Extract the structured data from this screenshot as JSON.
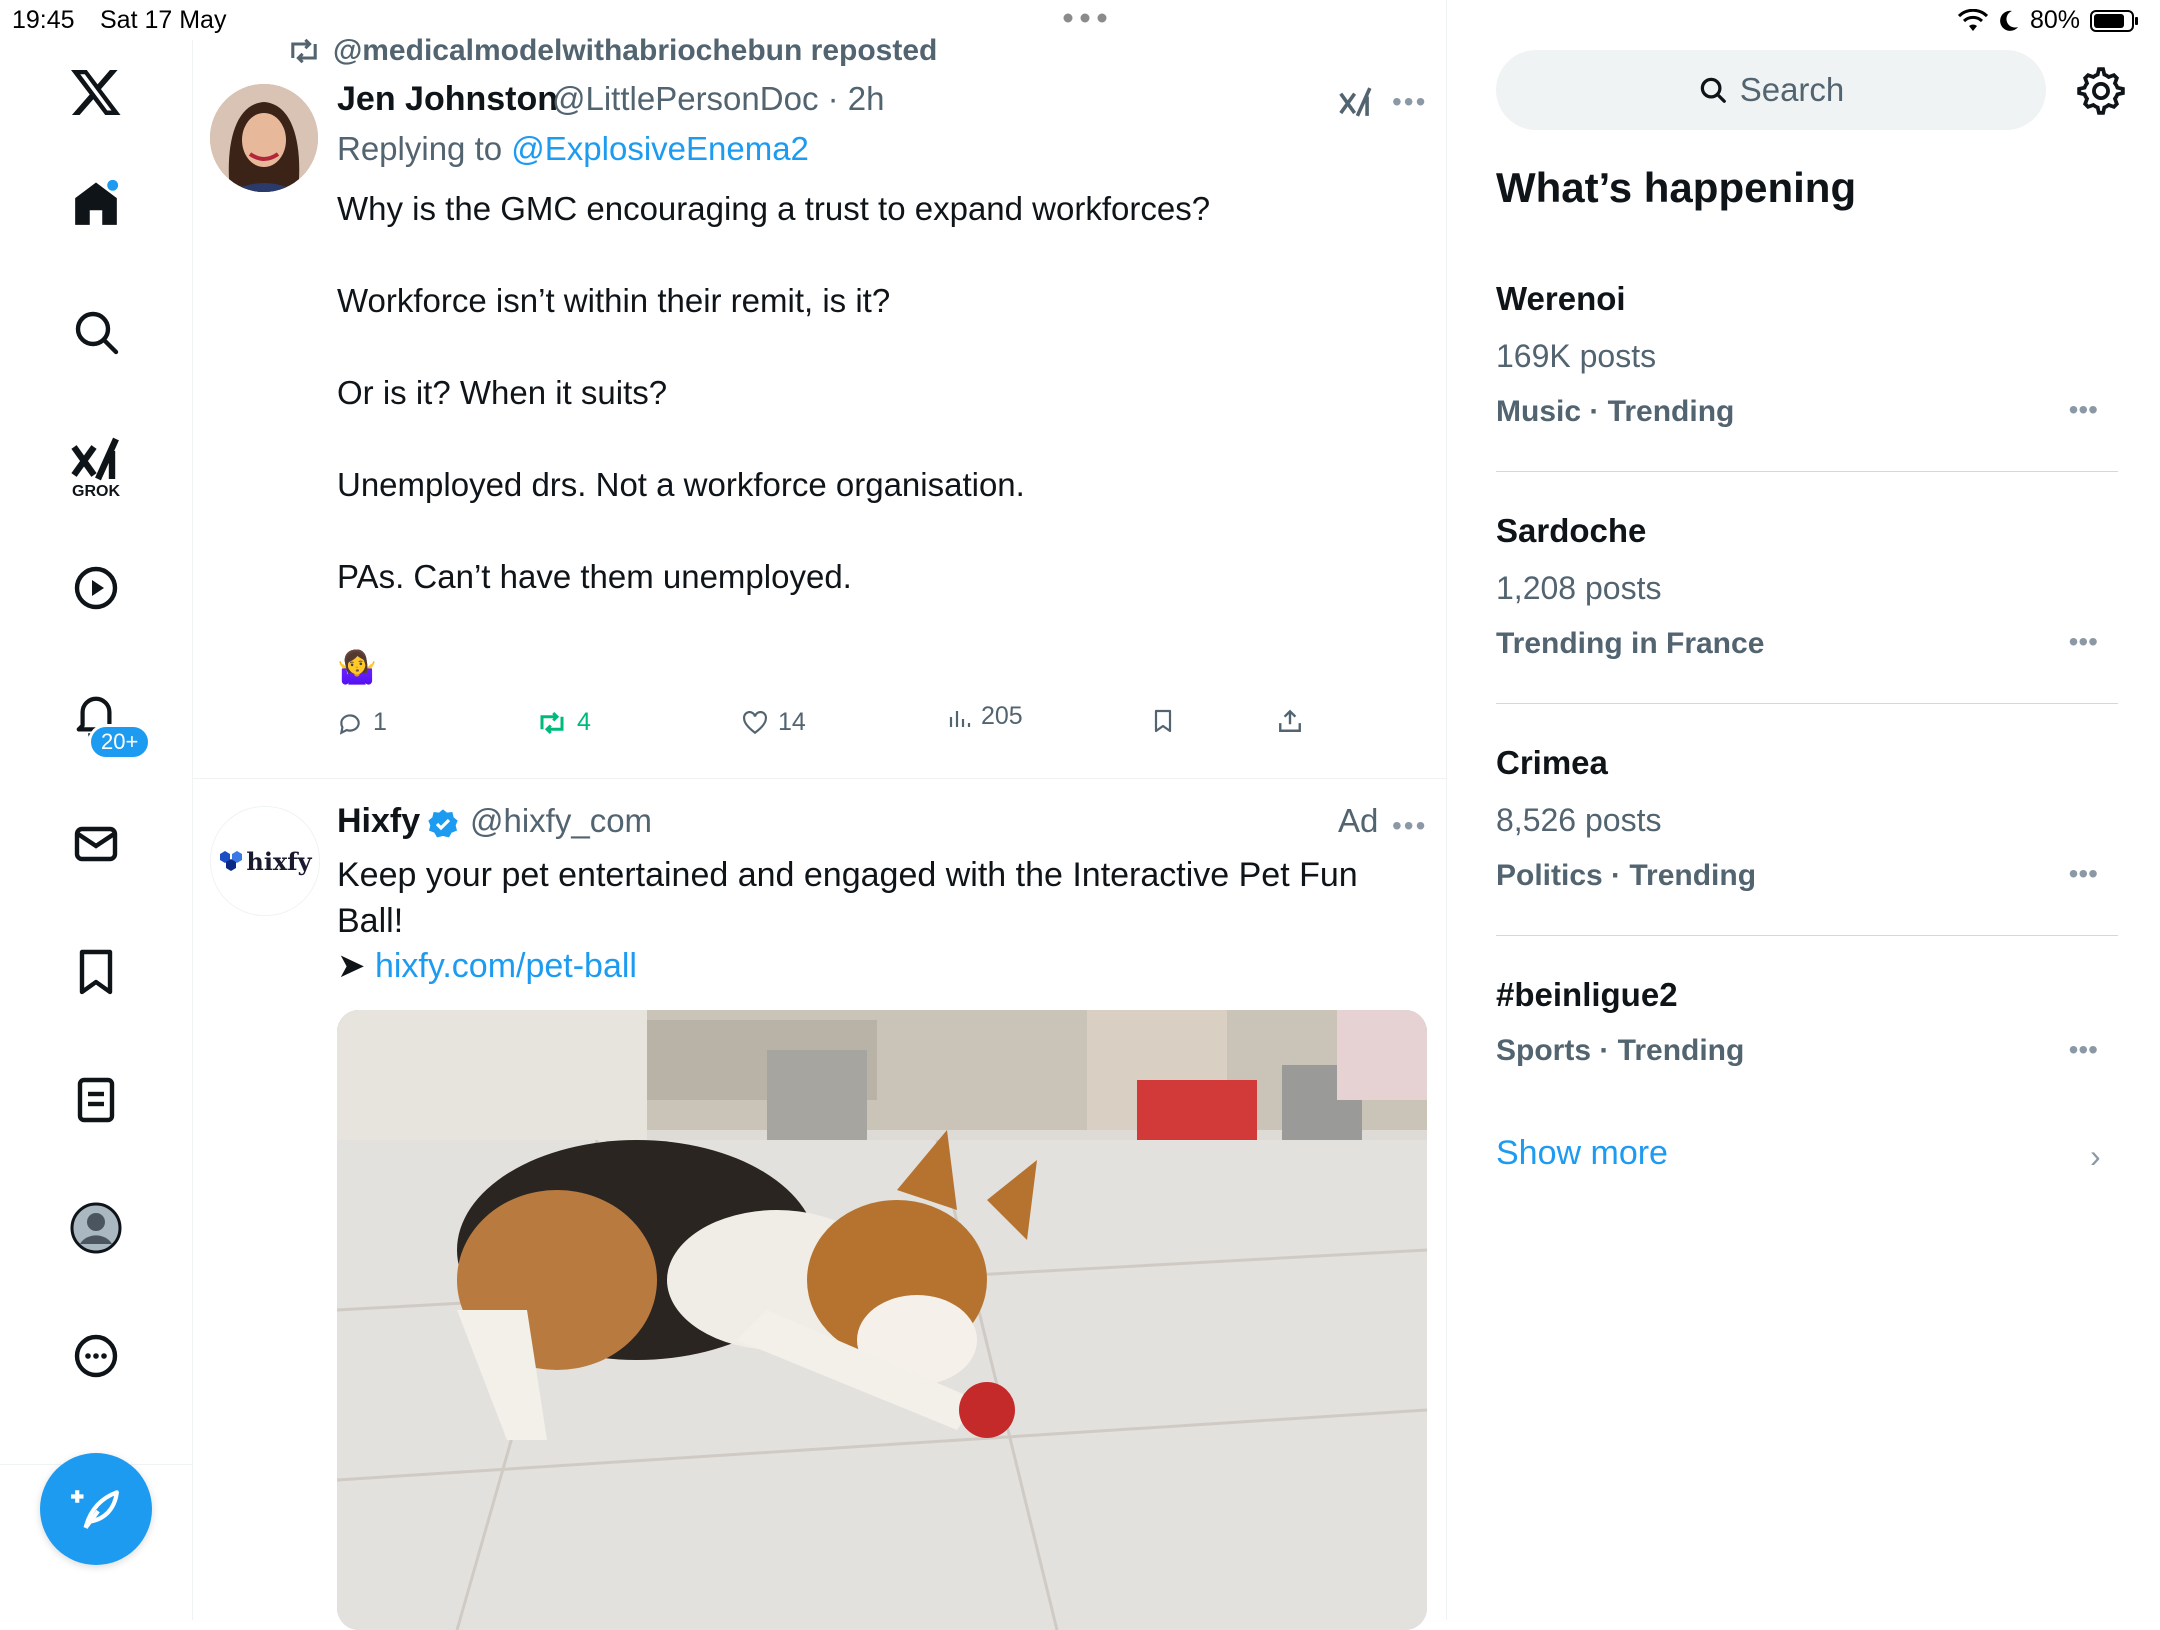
{
  "status": {
    "time": "19:45",
    "date": "Sat 17 May",
    "battery": "80%"
  },
  "nav": {
    "grok_label": "GROK",
    "notifications_badge": "20+"
  },
  "post": {
    "repost_text": "@medicalmodelwithabriochebun reposted",
    "name": "Jen Johnston",
    "handle_time": "@LittlePersonDoc · 2h",
    "replying_prefix": "Replying to ",
    "replying_handle": "@ExplosiveEnema2",
    "lines": [
      "Why is the GMC encouraging a trust to expand workforces?",
      "Workforce isn’t within their remit, is it?",
      "Or is it? When it suits?",
      "Unemployed drs. Not a workforce organisation.",
      "PAs. Can’t have them unemployed."
    ],
    "emoji": "🤷‍♀️",
    "replies": "1",
    "reposts": "4",
    "likes": "14",
    "views": "205"
  },
  "ad": {
    "name": "Hixfy",
    "handle": "@hixfy_com",
    "label": "Ad",
    "logo_text": "hixfy",
    "text": "Keep your pet entertained and engaged with the Interactive Pet Fun Ball!",
    "arrow": "➤",
    "link": "hixfy.com/pet-ball"
  },
  "sidebar": {
    "search_placeholder": "Search",
    "heading": "What’s happening",
    "trends": [
      {
        "name": "Werenoi",
        "posts": "169K posts",
        "meta": "Music · Trending"
      },
      {
        "name": "Sardoche",
        "posts": "1,208 posts",
        "meta": "Trending in France"
      },
      {
        "name": "Crimea",
        "posts": "8,526 posts",
        "meta": "Politics · Trending"
      },
      {
        "name": "#beinligue2",
        "posts": "",
        "meta": "Sports · Trending"
      }
    ],
    "show_more": "Show more"
  },
  "colors": {
    "accent": "#1d9bf0",
    "repost_green": "#00ba7c",
    "secondary_text": "#536471"
  }
}
